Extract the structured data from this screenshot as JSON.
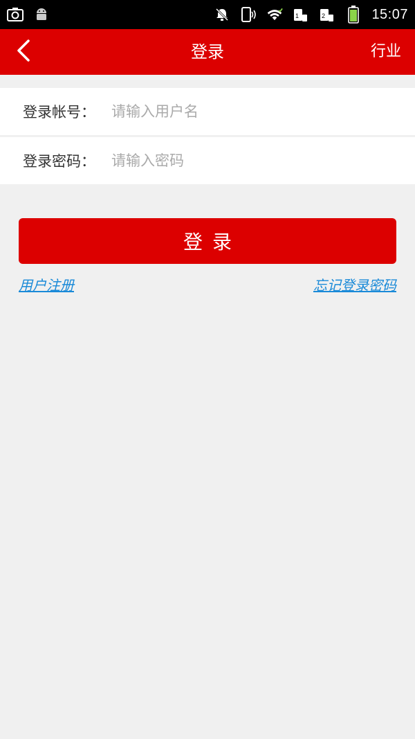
{
  "status_bar": {
    "time": "15:07",
    "icons": [
      "screenshot-icon",
      "android-icon",
      "bell-muted-icon",
      "vibrate-icon",
      "wifi-icon",
      "sim1-icon",
      "sim2-icon",
      "battery-icon"
    ]
  },
  "app_bar": {
    "title": "登录",
    "right_action": "行业",
    "back_icon": "chevron-left-icon"
  },
  "form": {
    "account_label": "登录帐号：",
    "account_placeholder": "请输入用户名",
    "account_value": "",
    "password_label": "登录密码：",
    "password_placeholder": "请输入密码",
    "password_value": ""
  },
  "login_button": "登录",
  "links": {
    "register": "用户注册",
    "forgot_password": "忘记登录密码"
  },
  "colors": {
    "primary": "#dc0000",
    "link": "#1a8ad8",
    "background": "#f0f0f0"
  }
}
